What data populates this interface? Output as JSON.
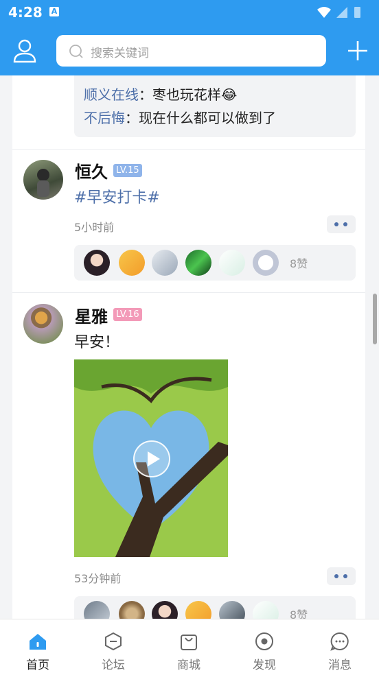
{
  "status_bar": {
    "time": "4:28",
    "notif_icon": "A"
  },
  "header": {
    "search_placeholder": "搜索关键词"
  },
  "comments": [
    {
      "name": "顺义在线",
      "text": "：枣也玩花样😂"
    },
    {
      "name": "不后悔",
      "text": "：现在什么都可以做到了"
    }
  ],
  "posts": [
    {
      "user": "恒久",
      "level": "LV.15",
      "level_color": "#8fb4ea",
      "text": "#早安打卡#",
      "text_color": "#4d6fa9",
      "time": "5小时前",
      "likes": "8赞"
    },
    {
      "user": "星雅",
      "level": "LV.16",
      "level_color": "#f39ab8",
      "text": "早安！",
      "text_color": "#222222",
      "time": "53分钟前",
      "likes": "8赞"
    }
  ],
  "nav": [
    {
      "label": "首页",
      "icon": "home-icon",
      "active": true
    },
    {
      "label": "论坛",
      "icon": "forum-icon",
      "active": false
    },
    {
      "label": "商城",
      "icon": "shop-bag-icon",
      "active": false
    },
    {
      "label": "发现",
      "icon": "discover-icon",
      "active": false
    },
    {
      "label": "消息",
      "icon": "message-icon",
      "active": false
    }
  ],
  "colors": {
    "brand": "#2e9bf0",
    "link": "#4d6fa9"
  }
}
